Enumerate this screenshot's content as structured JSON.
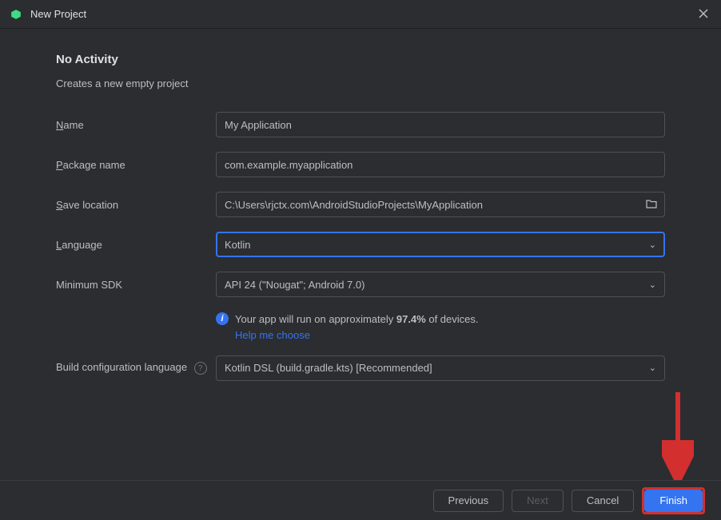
{
  "titlebar": {
    "title": "New Project"
  },
  "heading": "No Activity",
  "subtitle": "Creates a new empty project",
  "fields": {
    "name": {
      "label_pre": "N",
      "label_post": "ame",
      "value": "My Application"
    },
    "package": {
      "label_pre": "P",
      "label_post": "ackage name",
      "value": "com.example.myapplication"
    },
    "save": {
      "label_pre": "S",
      "label_post": "ave location",
      "value": "C:\\Users\\rjctx.com\\AndroidStudioProjects\\MyApplication"
    },
    "language": {
      "label_pre": "L",
      "label_post": "anguage",
      "value": "Kotlin"
    },
    "minsdk": {
      "label": "Minimum SDK",
      "value": "API 24 (\"Nougat\"; Android 7.0)"
    },
    "buildconfig": {
      "label": "Build configuration language",
      "value": "Kotlin DSL (build.gradle.kts) [Recommended]"
    }
  },
  "info": {
    "text_pre": "Your app will run on approximately ",
    "percent": "97.4%",
    "text_post": " of devices.",
    "link": "Help me choose"
  },
  "footer": {
    "previous": "Previous",
    "next": "Next",
    "cancel": "Cancel",
    "finish": "Finish"
  }
}
